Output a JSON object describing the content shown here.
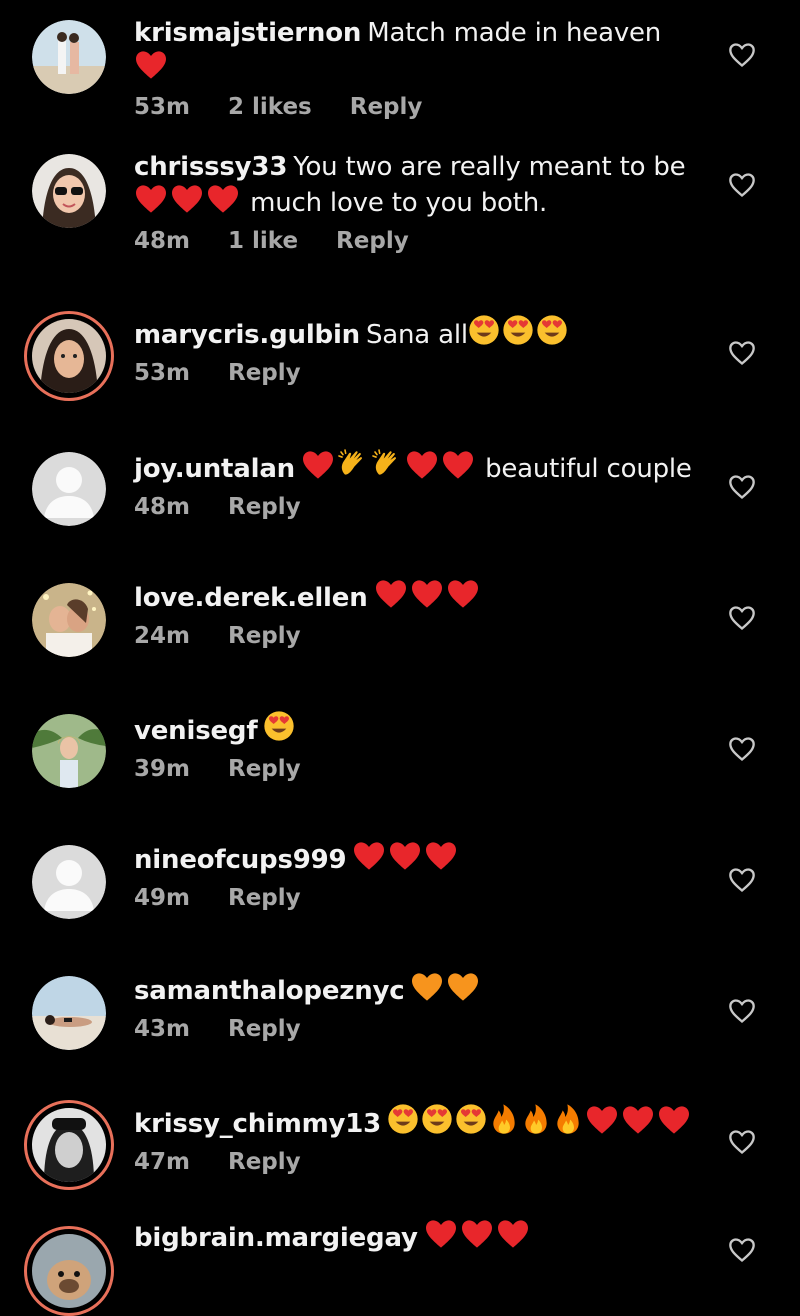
{
  "comments": [
    {
      "username": "krismajstiernon",
      "text": "Match made in heaven",
      "emoji_after": [
        "red-heart"
      ],
      "time": "53m",
      "likes": "2 likes",
      "reply": "Reply",
      "avatar": "photo-couple-beach",
      "ring": false
    },
    {
      "username": "chrisssy33",
      "text": "You two are really meant to be",
      "line2_emoji": [
        "red-heart",
        "red-heart",
        "red-heart"
      ],
      "line2_text": "much love to you both.",
      "time": "48m",
      "likes": "1 like",
      "reply": "Reply",
      "avatar": "photo-woman-sunglasses",
      "ring": false
    },
    {
      "username": "marycris.gulbin",
      "text": "Sana all",
      "emoji_after": [
        "heart-eyes",
        "heart-eyes",
        "heart-eyes"
      ],
      "time": "53m",
      "likes": "",
      "reply": "Reply",
      "avatar": "photo-woman-portrait",
      "ring": true
    },
    {
      "username": "joy.untalan",
      "text": "beautiful couple",
      "emoji_before": [
        "red-heart",
        "clapping-hands",
        "clapping-hands",
        "red-heart",
        "red-heart"
      ],
      "time": "48m",
      "likes": "",
      "reply": "Reply",
      "avatar": "default-avatar",
      "ring": false
    },
    {
      "username": "love.derek.ellen",
      "text": "",
      "emoji_after": [
        "red-heart",
        "red-heart",
        "red-heart"
      ],
      "time": "24m",
      "likes": "",
      "reply": "Reply",
      "avatar": "photo-couple-kiss",
      "ring": false
    },
    {
      "username": "venisegf",
      "text": "",
      "emoji_after": [
        "heart-eyes"
      ],
      "time": "39m",
      "likes": "",
      "reply": "Reply",
      "avatar": "photo-woman-tropical",
      "ring": false
    },
    {
      "username": "nineofcups999",
      "text": "",
      "emoji_after": [
        "red-heart",
        "red-heart",
        "red-heart"
      ],
      "time": "49m",
      "likes": "",
      "reply": "Reply",
      "avatar": "default-avatar",
      "ring": false
    },
    {
      "username": "samanthalopeznyc",
      "text": "",
      "emoji_after": [
        "orange-heart",
        "orange-heart"
      ],
      "time": "43m",
      "likes": "",
      "reply": "Reply",
      "avatar": "photo-woman-beach",
      "ring": false
    },
    {
      "username": "krissy_chimmy13",
      "text": "",
      "emoji_after": [
        "heart-eyes",
        "heart-eyes",
        "heart-eyes",
        "fire",
        "fire",
        "fire",
        "red-heart",
        "red-heart",
        "red-heart"
      ],
      "time": "47m",
      "likes": "",
      "reply": "Reply",
      "avatar": "photo-woman-bw",
      "ring": true
    },
    {
      "username": "bigbrain.margiegay",
      "text": "",
      "emoji_after": [
        "red-heart",
        "red-heart",
        "red-heart"
      ],
      "time": "",
      "likes": "",
      "reply": "",
      "avatar": "photo-dog",
      "ring": true
    }
  ],
  "colors": {
    "background": "#000000",
    "text": "#f2f2f2",
    "meta": "#a8a8a8",
    "story_ring": "#e8705a",
    "red_heart": "#e8262b",
    "orange_heart": "#f7941d"
  }
}
